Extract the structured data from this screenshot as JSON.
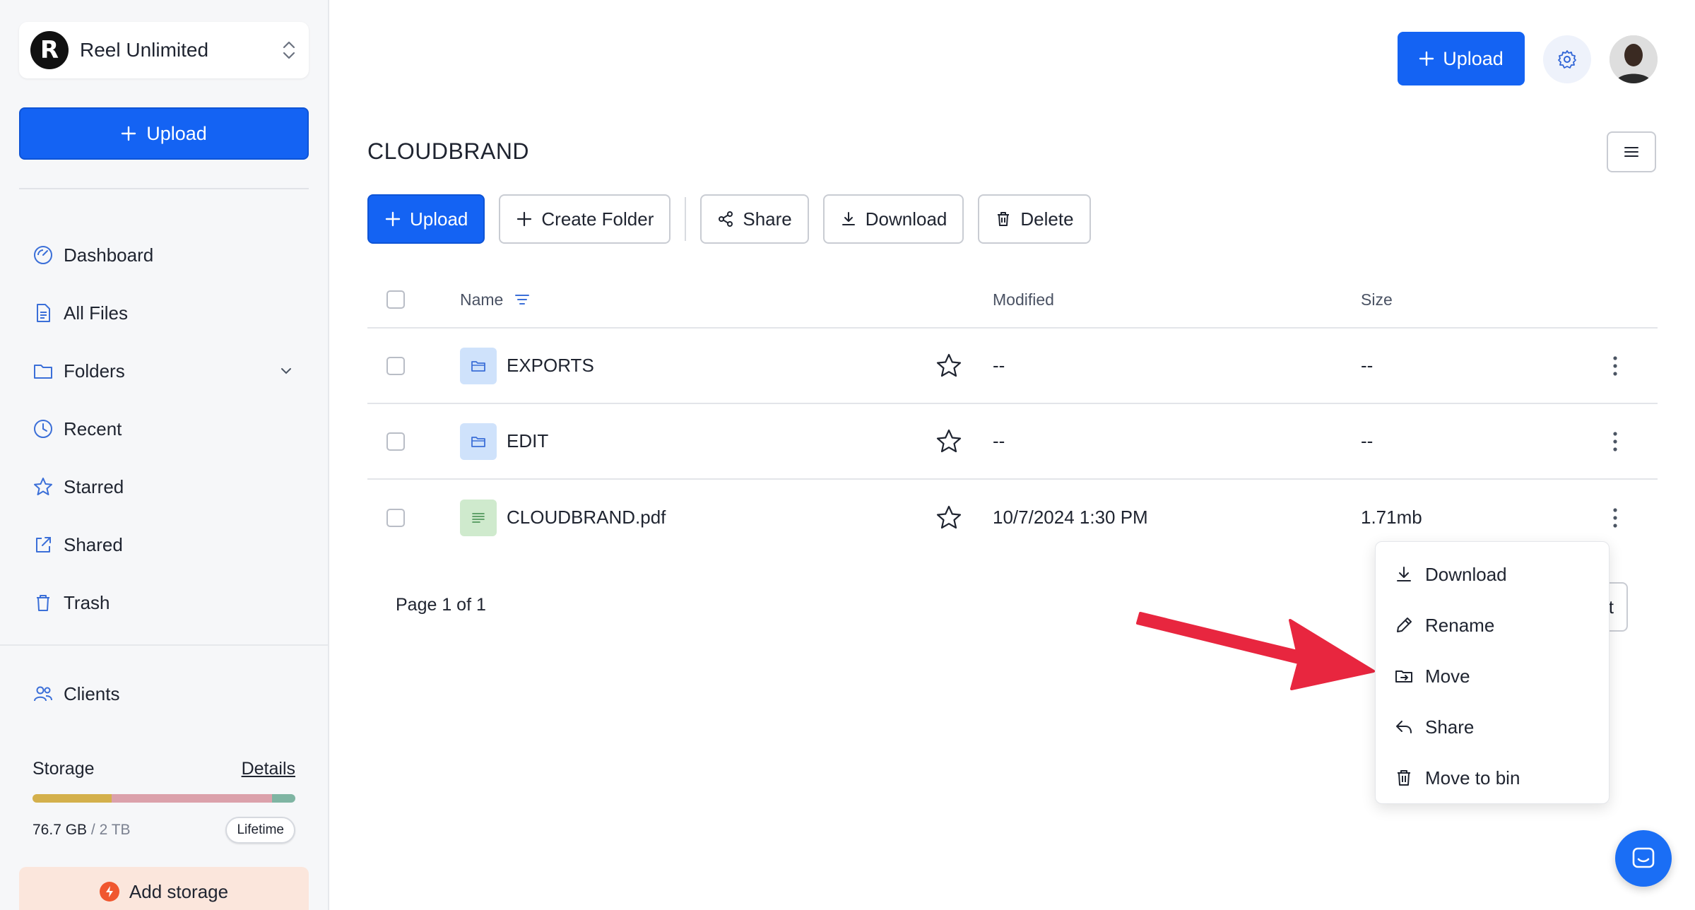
{
  "workspace": {
    "logo_letter": "R",
    "name": "Reel Unlimited"
  },
  "sidebar": {
    "upload_label": "Upload",
    "items": [
      {
        "label": "Dashboard",
        "icon": "dashboard-icon"
      },
      {
        "label": "All Files",
        "icon": "file-icon"
      },
      {
        "label": "Folders",
        "icon": "folder-icon"
      },
      {
        "label": "Recent",
        "icon": "clock-icon"
      },
      {
        "label": "Starred",
        "icon": "star-icon"
      },
      {
        "label": "Shared",
        "icon": "share-icon"
      },
      {
        "label": "Trash",
        "icon": "trash-icon"
      }
    ],
    "clients_label": "Clients",
    "storage": {
      "label": "Storage",
      "details_link": "Details",
      "used": "76.7 GB",
      "total": "/ 2 TB",
      "plan_badge": "Lifetime",
      "segments": [
        {
          "fraction": 0.3,
          "color": "#d4b04c"
        },
        {
          "fraction": 0.61,
          "color": "#dba1ab"
        },
        {
          "fraction": 0.09,
          "color": "#7fb5a3"
        }
      ]
    },
    "add_storage_label": "Add storage"
  },
  "header": {
    "upload_label": "Upload"
  },
  "main": {
    "title": "CLOUDBRAND",
    "toolbar": {
      "upload": "Upload",
      "create_folder": "Create Folder",
      "share": "Share",
      "download": "Download",
      "delete": "Delete"
    },
    "columns": {
      "name": "Name",
      "modified": "Modified",
      "size": "Size"
    },
    "rows": [
      {
        "name": "EXPORTS",
        "type": "folder",
        "modified": "--",
        "size": "--"
      },
      {
        "name": "EDIT",
        "type": "folder",
        "modified": "--",
        "size": "--"
      },
      {
        "name": "CLOUDBRAND.pdf",
        "type": "pdf",
        "modified": "10/7/2024 1:30 PM",
        "size": "1.71mb"
      }
    ],
    "pagination": {
      "text": "Page 1 of 1",
      "next_partial": "t"
    }
  },
  "context_menu": {
    "items": [
      {
        "label": "Download",
        "icon": "download-icon"
      },
      {
        "label": "Rename",
        "icon": "pencil-icon"
      },
      {
        "label": "Move",
        "icon": "move-folder-icon"
      },
      {
        "label": "Share",
        "icon": "reply-share-icon"
      },
      {
        "label": "Move to bin",
        "icon": "trash-icon"
      }
    ]
  },
  "colors": {
    "primary": "#1463f3",
    "annotation_arrow": "#e8263f"
  }
}
